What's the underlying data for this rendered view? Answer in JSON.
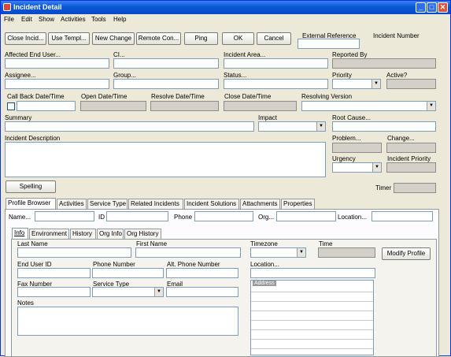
{
  "window": {
    "title": "Incident Detail"
  },
  "menu": [
    "File",
    "Edit",
    "Show",
    "Activities",
    "Tools",
    "Help"
  ],
  "toolbar": {
    "close_incident": "Close Incid...",
    "use_template": "Use Templ...",
    "new_change": "New Change",
    "remote_console": "Remote Con...",
    "ping": "Ping",
    "ok": "OK",
    "cancel": "Cancel",
    "external_reference_label": "External Reference",
    "incident_number_label": "Incident Number"
  },
  "fields": {
    "affected_end_user": "Affected End User...",
    "ci": "CI...",
    "incident_area": "Incident  Area...",
    "reported_by": "Reported By",
    "assignee": "Assignee...",
    "group": "Group...",
    "status": "Status...",
    "priority": "Priority",
    "active": "Active?",
    "call_back": "Call Back Date/Time",
    "open_date": "Open Date/Time",
    "resolve_date": "Resolve Date/Time",
    "close_date": "Close Date/Time",
    "resolving_version": "Resolving Version",
    "summary": "Summary",
    "impact": "Impact",
    "root_cause": "Root Cause...",
    "incident_description": "Incident Description",
    "problem": "Problem...",
    "change": "Change...",
    "urgency": "Urgency",
    "incident_priority": "Incident Priority",
    "spelling": "Spelling",
    "timer": "Timer"
  },
  "tabs": [
    "Profile Browser",
    "Activities",
    "Service Type",
    "Related Incidents",
    "Incident Solutions",
    "Attachments",
    "Properties"
  ],
  "profile": {
    "name": "Name...",
    "id": "ID",
    "phone": "Phone",
    "org": "Org...",
    "location": "Location..."
  },
  "subtabs": [
    "Info",
    "Environment",
    "History",
    "Org Info",
    "Org History"
  ],
  "info": {
    "last_name": "Last Name",
    "first_name": "First Name",
    "timezone": "Timezone",
    "time": "Time",
    "modify_profile": "Modify Profile",
    "end_user_id": "End User ID",
    "phone_number": "Phone Number",
    "alt_phone": "Alt. Phone Number",
    "location": "Location...",
    "fax_number": "Fax Number",
    "service_type": "Service Type",
    "email": "Email",
    "address": "Address",
    "notes": "Notes"
  }
}
